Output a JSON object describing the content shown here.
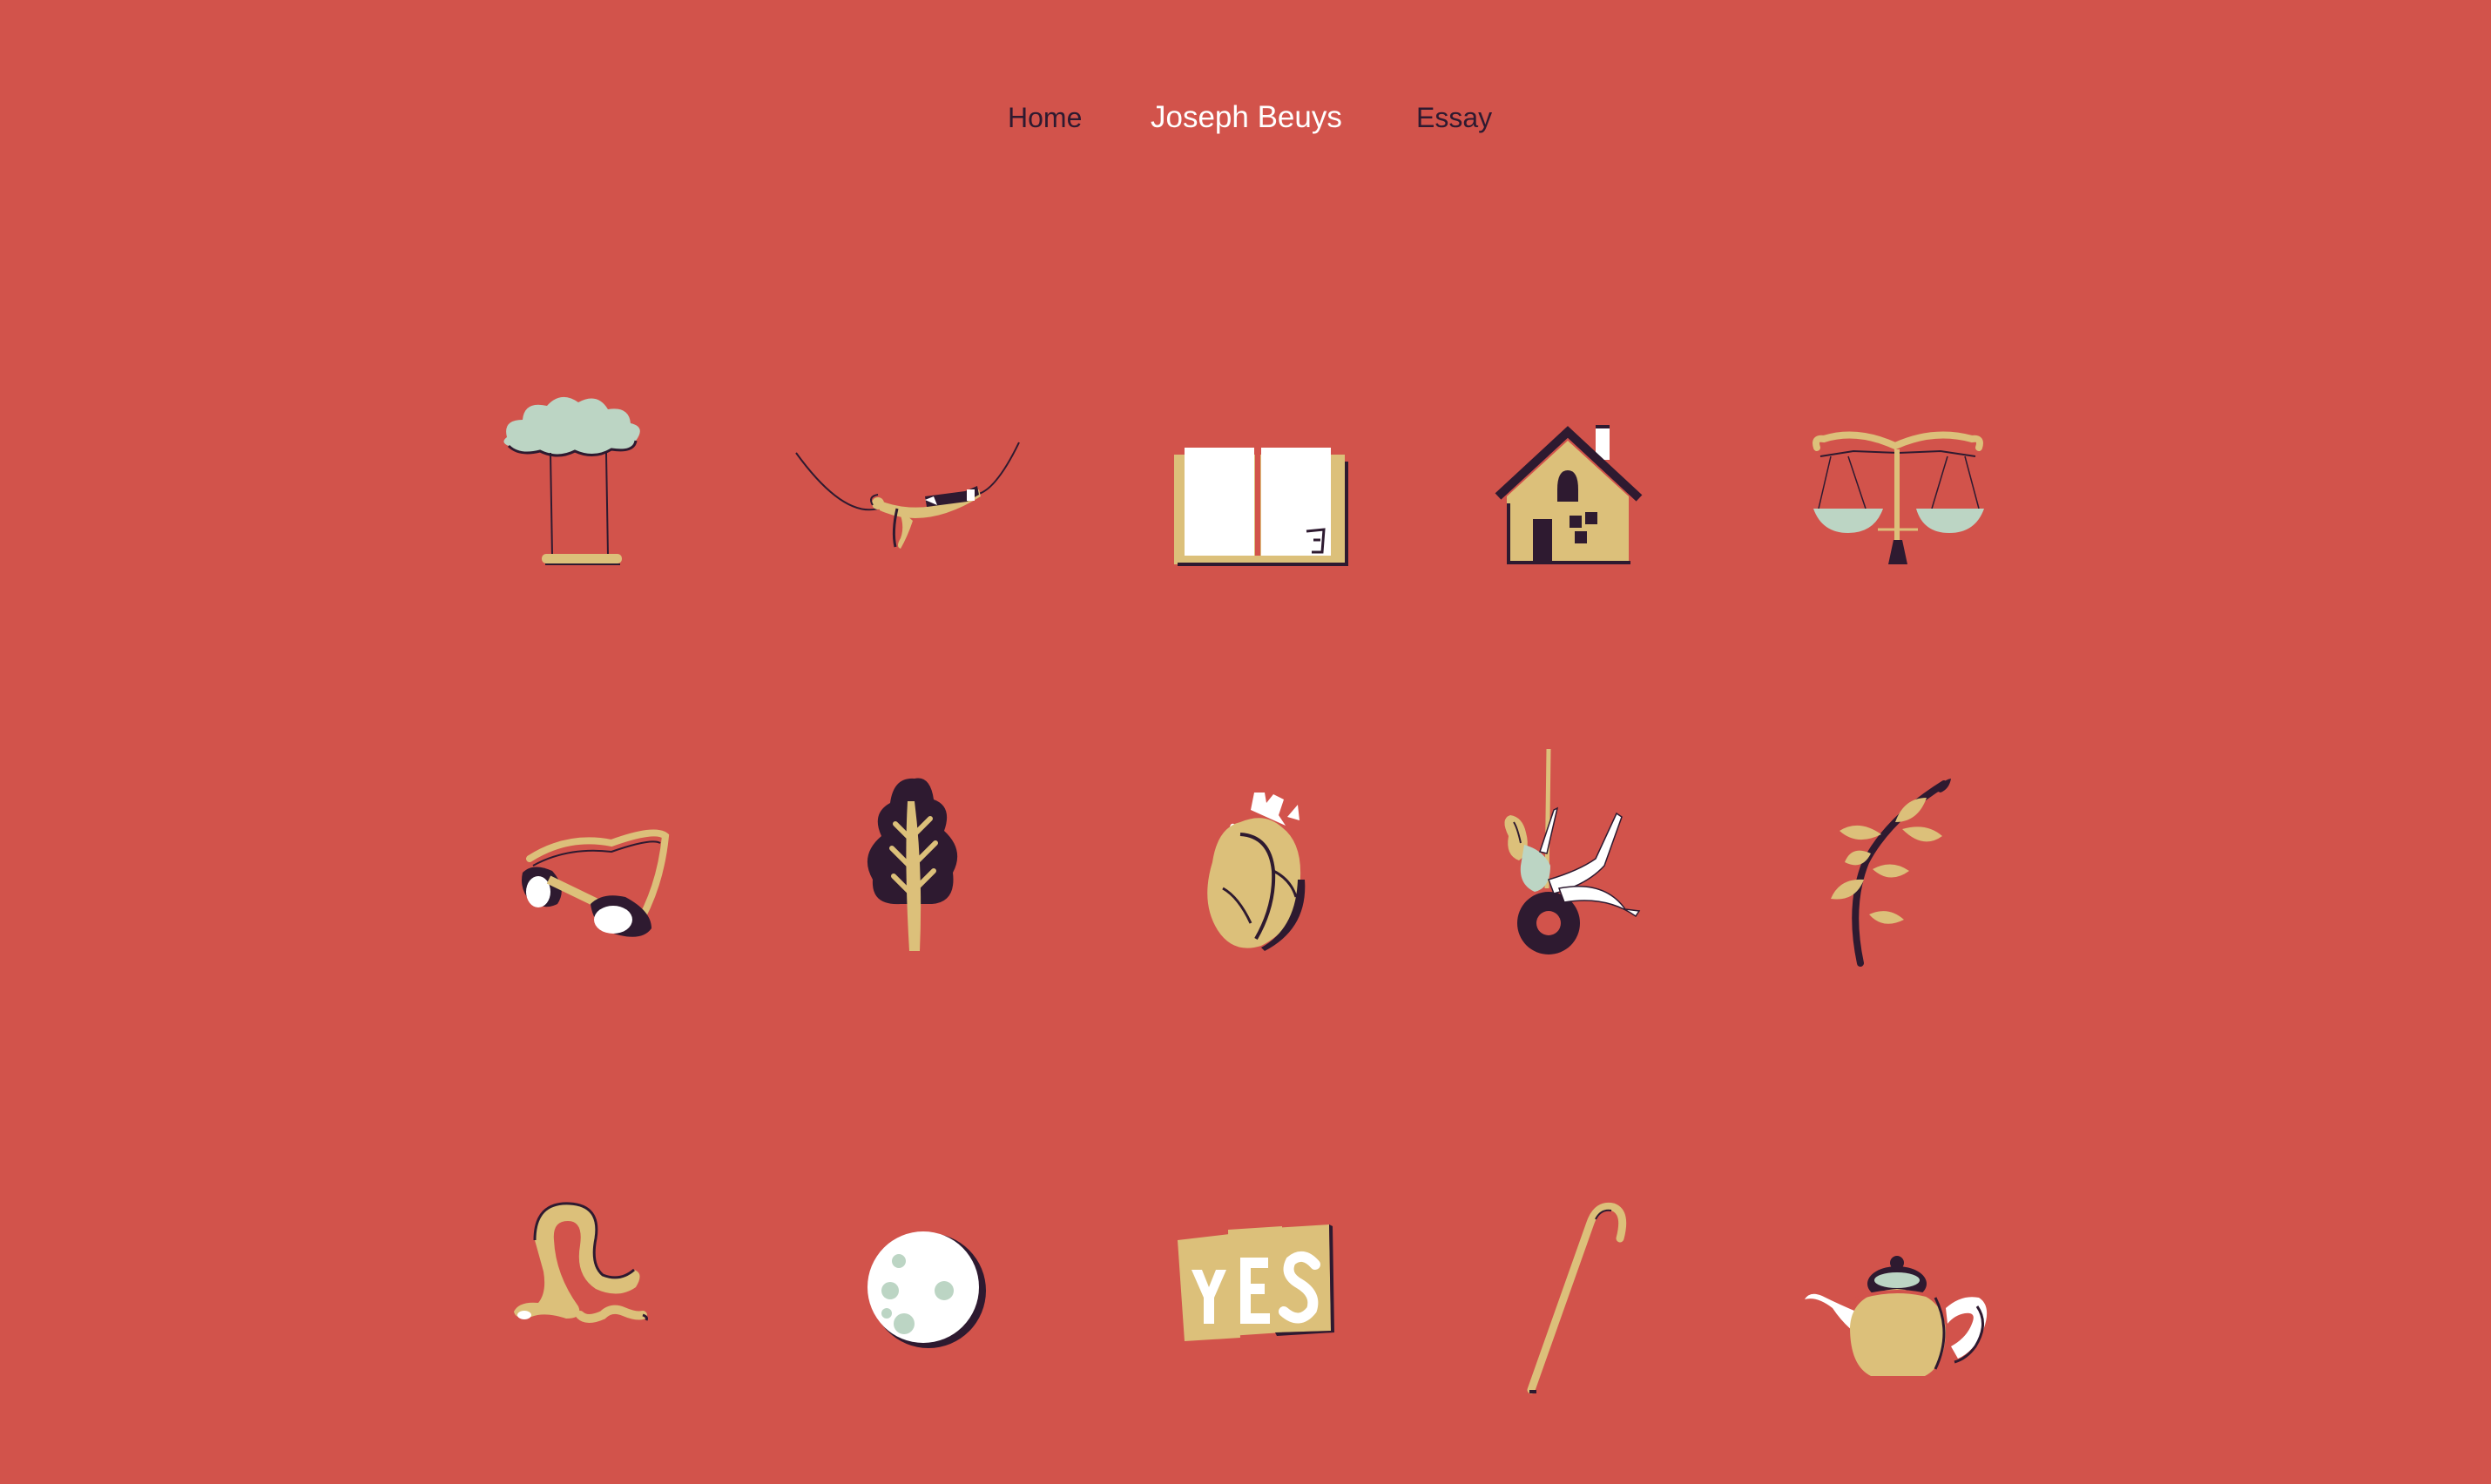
{
  "colors": {
    "background": "#d2534b",
    "dark": "#2e1a30",
    "gold": "#dcc07a",
    "mint": "#bcd5c4",
    "white": "#ffffff"
  },
  "nav": {
    "items": [
      {
        "label": "Home",
        "active": false
      },
      {
        "label": "Joseph Beuys",
        "active": true
      },
      {
        "label": "Essay",
        "active": false
      }
    ]
  },
  "gallery": {
    "icons": [
      "cloud-swing-icon",
      "hammock-figure-icon",
      "open-book-icon",
      "house-icon",
      "scales-icon",
      "goggles-icon",
      "tree-icon",
      "anatomical-heart-icon",
      "tire-swing-figure-icon",
      "leafy-branch-icon",
      "snake-icon",
      "moon-icon",
      "yes-cards-icon",
      "walking-cane-icon",
      "teapot-icon"
    ]
  }
}
